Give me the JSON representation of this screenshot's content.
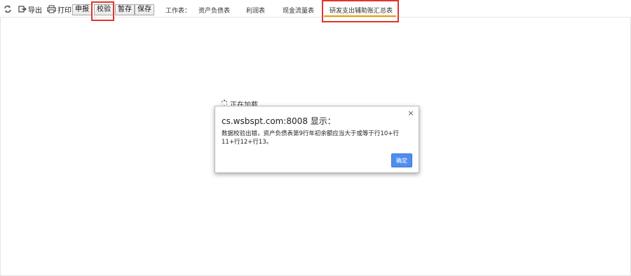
{
  "toolbar": {
    "export_label": "导出",
    "print_label": "打印",
    "buttons": {
      "declare": "申报",
      "verify": "校验",
      "save_temp": "暂存",
      "save": "保存"
    },
    "worksheet_label": "工作表：",
    "tabs": [
      {
        "label": "资产负债表"
      },
      {
        "label": "利润表"
      },
      {
        "label": "现金流量表"
      },
      {
        "label": "研发支出辅助账汇总表",
        "active": true
      }
    ]
  },
  "loading": {
    "text": "正在加载..."
  },
  "dialog": {
    "title": "cs.wsbspt.com:8008 显示：",
    "message": "数据校验出错，资产负债表第9行年初余额应当大于或等于行10+行11+行12+行13。",
    "ok_label": "确定",
    "close_symbol": "×"
  },
  "colors": {
    "highlight_red": "#e0352e",
    "active_tab_underline": "#e0a200",
    "ok_button": "#4f8ef0"
  },
  "icons": [
    "refresh-icon",
    "export-icon",
    "print-icon",
    "spinner-icon",
    "close-icon"
  ]
}
